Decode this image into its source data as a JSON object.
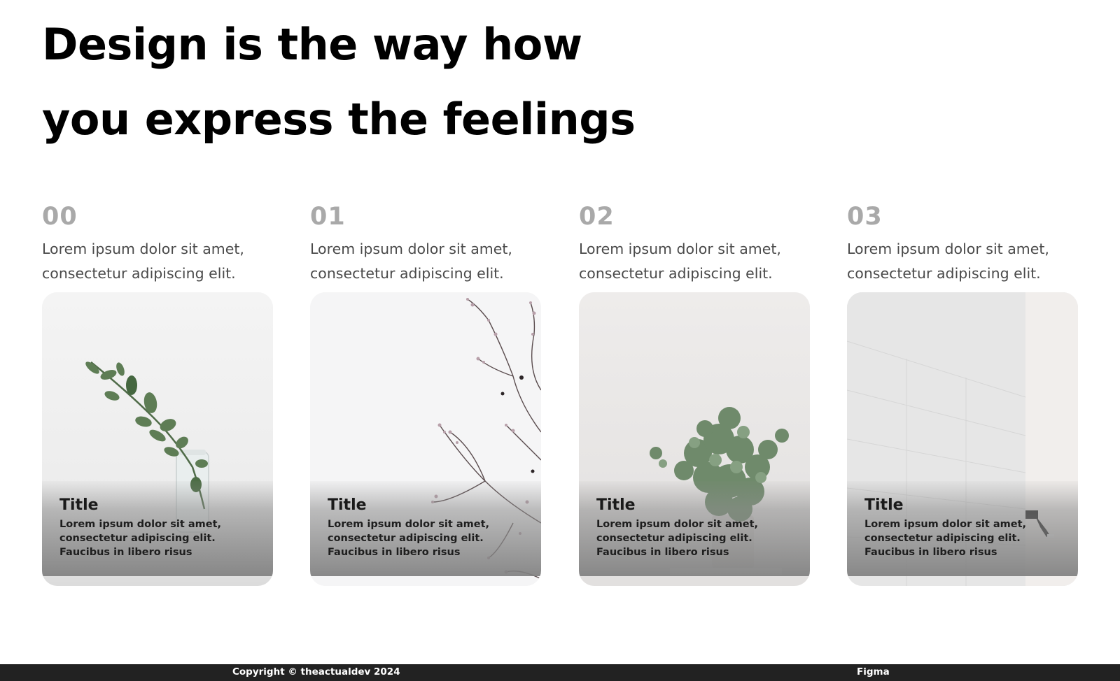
{
  "hero": {
    "title": "Design is the way how you express the feelings"
  },
  "cards": [
    {
      "number": "00",
      "intro": "Lorem ipsum dolor sit amet,\nconsectetur adipiscing elit.",
      "image": "eucalyptus-sprig-in-jar",
      "title": "Title",
      "description": "Lorem ipsum dolor sit amet,\nconsectetur adipiscing elit.\nFaucibus in libero risus"
    },
    {
      "number": "01",
      "intro": "Lorem ipsum dolor sit amet,\nconsectetur adipiscing elit.",
      "image": "blossom-branches",
      "title": "Title",
      "description": "Lorem ipsum dolor sit amet,\nconsectetur adipiscing elit.\nFaucibus in libero risus"
    },
    {
      "number": "02",
      "intro": "Lorem ipsum dolor sit amet,\nconsectetur adipiscing elit.",
      "image": "potted-eucalyptus-plant",
      "title": "Title",
      "description": "Lorem ipsum dolor sit amet,\nconsectetur adipiscing elit.\nFaucibus in libero risus"
    },
    {
      "number": "03",
      "intro": "Lorem ipsum dolor sit amet,\nconsectetur adipiscing elit.",
      "image": "person-sitting-by-white-wall",
      "title": "Title",
      "description": "Lorem ipsum dolor sit amet,\nconsectetur adipiscing elit.\nFaucibus in libero risus"
    }
  ],
  "footer": {
    "copyright": "Copyright © theactualdev 2024",
    "link": "Figma"
  }
}
